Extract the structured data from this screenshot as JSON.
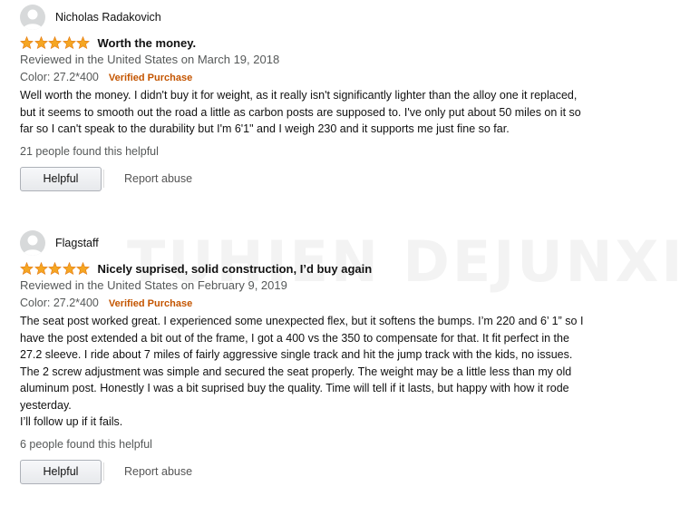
{
  "watermark": "TUHIEN DEJUNXI",
  "reviews": [
    {
      "author": "Nicholas Radakovich",
      "rating": 5,
      "headline": "Worth the money.",
      "date": "Reviewed in the United States on March 19, 2018",
      "format": "Color: 27.2*400",
      "verified": "Verified Purchase",
      "body": [
        "Well worth the money. I didn't buy it for weight, as it really isn't significantly lighter than the alloy one it replaced, but it seems to smooth out the road a little as carbon posts are supposed to. I've only put about 50 miles on it so far so I can't speak to the durability but I'm 6'1\" and I weigh 230 and it supports me just fine so far."
      ],
      "helpful_count": "21 people found this helpful",
      "helpful_label": "Helpful",
      "report_label": "Report abuse"
    },
    {
      "author": "Flagstaff",
      "rating": 5,
      "headline": "Nicely suprised, solid construction, I’d buy again",
      "date": "Reviewed in the United States on February 9, 2019",
      "format": "Color: 27.2*400",
      "verified": "Verified Purchase",
      "body": [
        "The seat post worked great. I experienced some unexpected flex, but it softens the bumps. I’m 220 and 6’ 1” so I have the post extended a bit out of the frame, I got a 400 vs the 350 to compensate for that. It fit perfect in the 27.2 sleeve. I ride about 7 miles of fairly aggressive single track and hit the jump track with the kids, no issues. The 2 screw adjustment was simple and secured the seat properly. The weight may be a little less than my old aluminum post. Honestly I was a bit suprised buy the quality. Time will tell if it lasts, but happy with how it rode yesterday.",
        "I’ll follow up if it fails."
      ],
      "helpful_count": "6 people found this helpful",
      "helpful_label": "Helpful",
      "report_label": "Report abuse"
    }
  ],
  "colors": {
    "star": "#f5a623",
    "star_outline": "#e47911",
    "verified": "#c45500",
    "secondary_text": "#565959"
  },
  "icons": {
    "avatar": "user-avatar-icon",
    "star": "star-icon"
  }
}
